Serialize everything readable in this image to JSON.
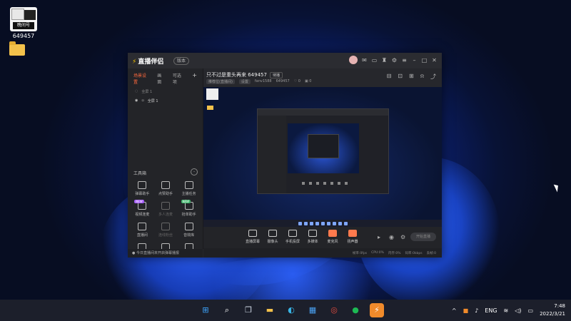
{
  "desktop": {
    "icons": [
      {
        "label": "649457",
        "icon": "live-companion-app-icon",
        "badge": "晚间号"
      },
      {
        "label": "",
        "icon": "folder-icon"
      }
    ]
  },
  "window": {
    "app_name": "直播伴侣",
    "version_label": "版本",
    "sidebar": {
      "tabs": [
        "场景设置",
        "画面",
        "可选项"
      ],
      "scenes": [
        "全屏 1",
        "全屏 1"
      ],
      "tools_heading": "工具箱",
      "tools": [
        {
          "label": "弹幕助手",
          "badge": ""
        },
        {
          "label": "点赞助手",
          "badge": ""
        },
        {
          "label": "主播任务",
          "badge": ""
        },
        {
          "label": "视频连麦",
          "badge": "NEW"
        },
        {
          "label": "多人连麦",
          "badge": ""
        },
        {
          "label": "抢单助手",
          "badge": "NEW"
        },
        {
          "label": "直播间",
          "badge": ""
        },
        {
          "label": "连线粉丝",
          "badge": ""
        },
        {
          "label": "音效库",
          "badge": ""
        },
        {
          "label": "",
          "badge": ""
        },
        {
          "label": "",
          "badge": ""
        },
        {
          "label": "",
          "badge": ""
        }
      ],
      "notice": "今日直播间未开启弹幕播报"
    },
    "room": {
      "title": "只不过是重头再来 649457",
      "tag": "待播",
      "info": [
        "推荐位(直播间)",
        "设置",
        "fanv1588",
        "649457",
        "0",
        "0"
      ]
    },
    "controls": [
      "直播屏幕",
      "摄像头",
      "手机投屏",
      "多媒体",
      "麦克风",
      "扬声器"
    ],
    "go_live": "开始直播",
    "stats": [
      "帧率:0fps",
      "CPU:0%",
      "内存:0%",
      "码率:0kbps",
      "丢帧:0"
    ]
  },
  "taskbar": {
    "apps": [
      {
        "icon": "windows-start-icon",
        "color": "#3ea6ff"
      },
      {
        "icon": "search-icon",
        "color": "#ffffff"
      },
      {
        "icon": "task-view-icon",
        "color": "#cfd8e6"
      },
      {
        "icon": "file-explorer-icon",
        "color": "#f3c14b"
      },
      {
        "icon": "edge-icon",
        "color": "#39b5e6"
      },
      {
        "icon": "store-icon",
        "color": "#4aa3f5"
      },
      {
        "icon": "chrome-icon",
        "color": "#e34b3e"
      },
      {
        "icon": "spotify-icon",
        "color": "#1db954"
      },
      {
        "icon": "live-companion-icon",
        "color": "#f18b2b"
      }
    ],
    "tray": {
      "language": "ENG",
      "time": "7:48",
      "date": "2022/3/21"
    }
  }
}
